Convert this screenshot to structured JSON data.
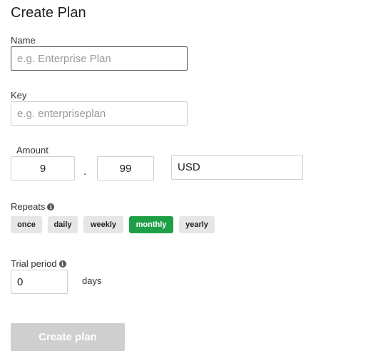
{
  "page_title": "Create Plan",
  "name": {
    "label": "Name",
    "placeholder": "e.g. Enterprise Plan",
    "value": ""
  },
  "key": {
    "label": "Key",
    "placeholder": "e.g. enterpriseplan",
    "value": ""
  },
  "amount": {
    "label": "Amount",
    "whole": "9",
    "separator": ".",
    "fraction": "99",
    "currency": "USD"
  },
  "repeats": {
    "label": "Repeats",
    "info_icon": "info-icon",
    "options": [
      "once",
      "daily",
      "weekly",
      "monthly",
      "yearly"
    ],
    "selected": "monthly",
    "active_color": "#1fa048"
  },
  "trial": {
    "label": "Trial period",
    "value": "0",
    "unit": "days"
  },
  "submit": {
    "label": "Create plan",
    "disabled": true
  }
}
